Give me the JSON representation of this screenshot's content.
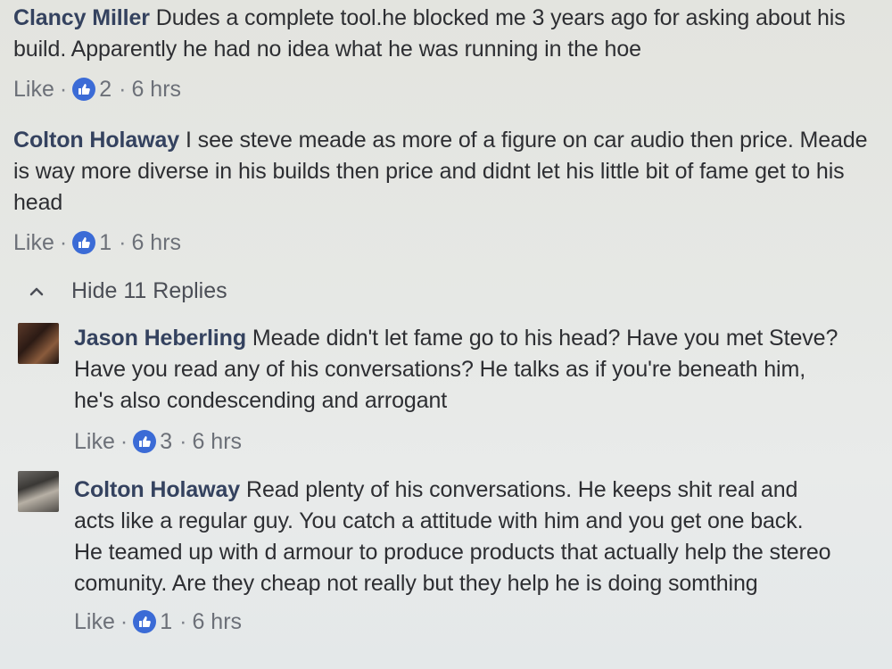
{
  "comments": [
    {
      "author": "Clancy Miller",
      "text": "Dudes a complete tool.he blocked me 3 years ago for asking about his build. Apparently he had no idea what he was running in the hoe",
      "like_label": "Like",
      "reactions": "2",
      "time": "6 hrs"
    },
    {
      "author": "Colton Holaway",
      "text": "I see steve meade as more of a figure on car audio then price. Meade is way more diverse in his builds then price and didnt let his little bit of fame get to his head",
      "like_label": "Like",
      "reactions": "1",
      "time": "6 hrs"
    }
  ],
  "replies_toggle": {
    "label": "Hide 11 Replies"
  },
  "replies": [
    {
      "author": "Jason Heberling",
      "text": "Meade didn't let fame go to his head? Have you met Steve? Have you read any of his conversations? He talks as if you're beneath him, he's also condescending and arrogant",
      "like_label": "Like",
      "reactions": "3",
      "time": "6 hrs"
    },
    {
      "author": "Colton Holaway",
      "text": "Read plenty of his conversations. He keeps shit real and acts like a regular guy. You catch a attitude with him and you get one back. He teamed up with d armour to produce products that actually help the stereo comunity. Are they cheap not really but they help he is doing somthing",
      "like_label": "Like",
      "reactions": "1",
      "time": "6 hrs"
    }
  ],
  "colors": {
    "author": "#34425f",
    "like_icon": "#3b6bd6",
    "meta": "#6c7078"
  },
  "icons": {
    "reaction": "thumbs-up-icon",
    "toggle": "chevron-up-icon"
  }
}
